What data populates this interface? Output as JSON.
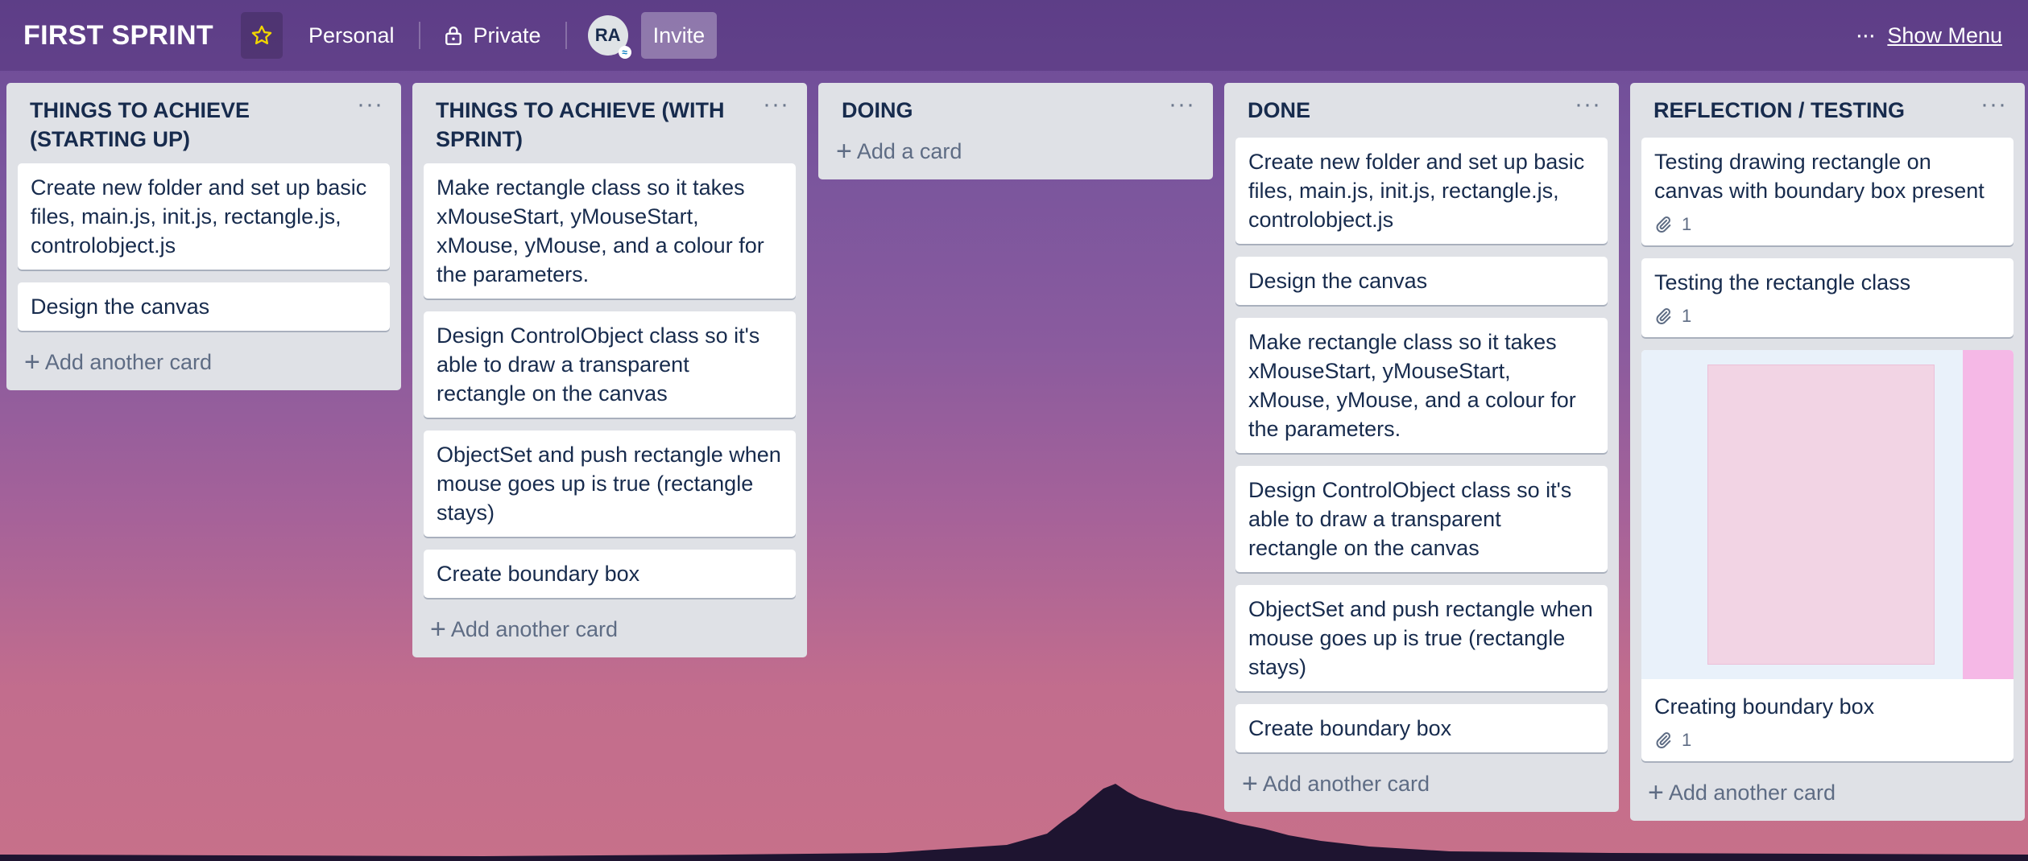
{
  "header": {
    "board_title": "FIRST SPRINT",
    "personal_label": "Personal",
    "private_label": "Private",
    "avatar_initials": "RA",
    "invite_label": "Invite",
    "show_menu_label": "Show Menu",
    "icons": [
      "star-icon",
      "lock-icon",
      "ellipsis-icon"
    ]
  },
  "lists": [
    {
      "title": "THINGS TO ACHIEVE (STARTING UP)",
      "cards": [
        "Create new folder and set up basic files, main.js, init.js, rectangle.js, controlobject.js",
        "Design the canvas"
      ],
      "add_label": "Add another card"
    },
    {
      "title": "THINGS TO ACHIEVE (WITH SPRINT)",
      "cards": [
        "Make rectangle class so it takes xMouseStart, yMouseStart, xMouse, yMouse, and a colour for the parameters.",
        "Design ControlObject class so it's able to draw a transparent rectangle on the canvas",
        "ObjectSet and push rectangle when mouse goes up is true (rectangle stays)",
        "Create boundary box"
      ],
      "add_label": "Add another card"
    },
    {
      "title": "DOING",
      "cards": [],
      "add_label": "Add a card"
    },
    {
      "title": "DONE",
      "cards": [
        "Create new folder and set up basic files, main.js, init.js, rectangle.js, controlobject.js",
        "Design the canvas",
        "Make rectangle class so it takes xMouseStart, yMouseStart, xMouse, yMouse, and a colour for the parameters.",
        "Design ControlObject class so it's able to draw a transparent rectangle on the canvas",
        "ObjectSet and push rectangle when mouse goes up is true (rectangle stays)",
        "Create boundary box"
      ],
      "add_label": "Add another card"
    },
    {
      "title": "REFLECTION / TESTING",
      "cards": [
        {
          "title": "Testing drawing rectangle on canvas with boundary box present",
          "attachments": "1"
        },
        {
          "title": "Testing the rectangle class",
          "attachments": "1"
        },
        {
          "title": "Creating boundary box",
          "attachments": "1",
          "has_cover": true
        }
      ],
      "add_label": "Add another card"
    }
  ]
}
